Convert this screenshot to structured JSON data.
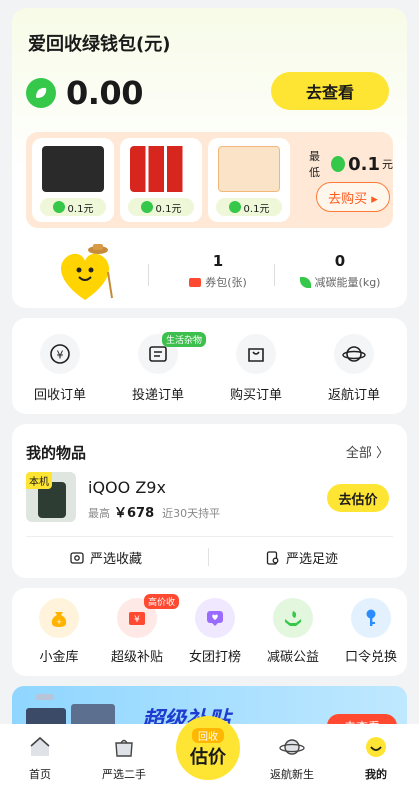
{
  "wallet": {
    "title": "爱回收绿钱包(元)",
    "balance": "0.00",
    "view_label": "去查看",
    "products": [
      {
        "price": "0.1元"
      },
      {
        "price": "0.1元"
      },
      {
        "price": "0.1元"
      }
    ],
    "min_prefix": "最低",
    "min_value": "0.1",
    "min_unit": "元",
    "buy_label": "去购买 ▸",
    "stats": [
      {
        "value": "1",
        "label": "券包(张)"
      },
      {
        "value": "0",
        "label": "减碳能量(kg)"
      }
    ]
  },
  "orders": {
    "items": [
      {
        "label": "回收订单"
      },
      {
        "label": "投递订单",
        "tag": "生活杂物"
      },
      {
        "label": "购买订单"
      },
      {
        "label": "返航订单"
      }
    ]
  },
  "my_items": {
    "title": "我的物品",
    "all_label": "全部 〉",
    "device": {
      "tag": "本机",
      "name": "iQOO Z9x",
      "price_prefix": "最高",
      "price": "￥678",
      "keep": "近30天持平",
      "estimate_label": "去估价"
    },
    "footer": [
      {
        "label": "严选收藏"
      },
      {
        "label": "严选足迹"
      }
    ]
  },
  "services": [
    {
      "label": "小金库"
    },
    {
      "label": "超级补贴",
      "tag": "高价收"
    },
    {
      "label": "女团打榜"
    },
    {
      "label": "减碳公益"
    },
    {
      "label": "口令兑换"
    }
  ],
  "banner": {
    "title": "超级补贴",
    "button": "去查看"
  },
  "tabbar": {
    "items": [
      {
        "label": "首页"
      },
      {
        "label": "严选二手"
      },
      {
        "label": "返航新生"
      },
      {
        "label": "我的"
      }
    ],
    "center_small": "回收",
    "center_big": "估价"
  },
  "colors": {
    "accent_yellow": "#ffe533",
    "green": "#35c84a",
    "orange": "#ff7a3a",
    "red": "#ff4930"
  }
}
